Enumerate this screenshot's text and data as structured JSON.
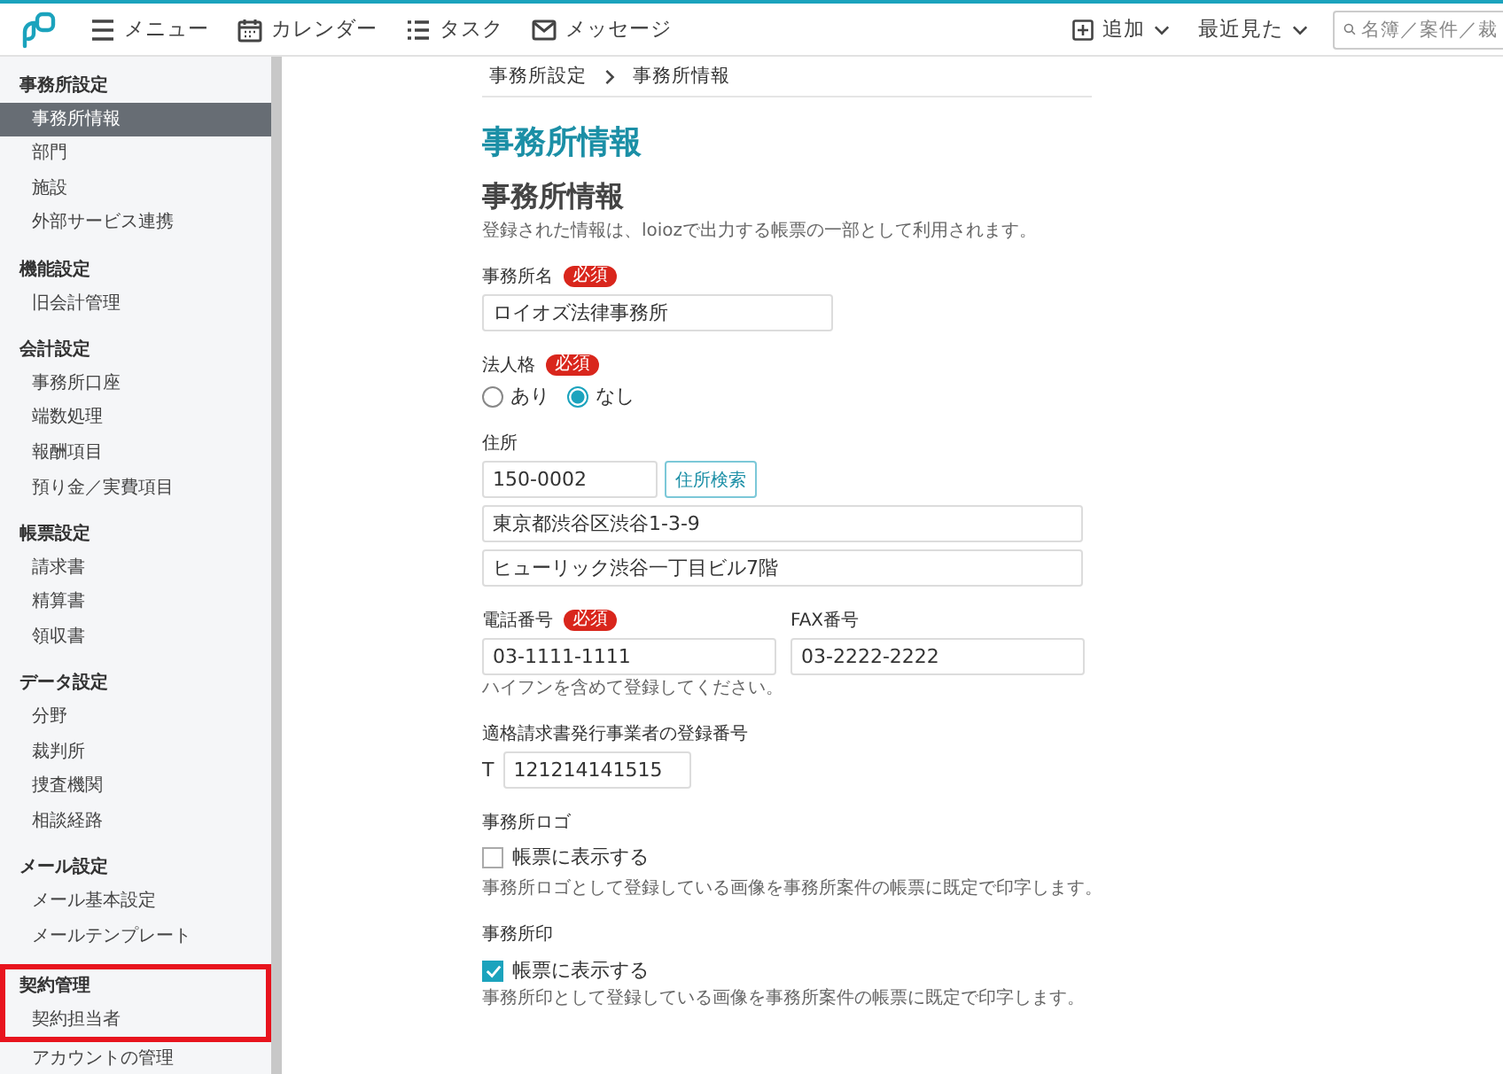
{
  "header": {
    "nav": [
      {
        "kind": "menu",
        "label": "メニュー"
      },
      {
        "kind": "calendar",
        "label": "カレンダー"
      },
      {
        "kind": "tasks",
        "label": "タスク"
      },
      {
        "kind": "message",
        "label": "メッセージ"
      }
    ],
    "add": "追加",
    "recent": "最近見た",
    "search": {
      "placeholder": "名簿／案件／裁"
    }
  },
  "sidebar": [
    {
      "kind": "header",
      "label": "事務所設定",
      "highlighted": false
    },
    {
      "kind": "item",
      "label": "事務所情報",
      "selected": true,
      "highlighted": false
    },
    {
      "kind": "item",
      "label": "部門",
      "selected": false,
      "highlighted": false
    },
    {
      "kind": "item",
      "label": "施設",
      "selected": false,
      "highlighted": false
    },
    {
      "kind": "item",
      "label": "外部サービス連携",
      "selected": false,
      "highlighted": false
    },
    {
      "kind": "header",
      "label": "機能設定",
      "highlighted": false
    },
    {
      "kind": "item",
      "label": "旧会計管理",
      "selected": false,
      "highlighted": false
    },
    {
      "kind": "header",
      "label": "会計設定",
      "highlighted": false
    },
    {
      "kind": "item",
      "label": "事務所口座",
      "selected": false,
      "highlighted": false
    },
    {
      "kind": "item",
      "label": "端数処理",
      "selected": false,
      "highlighted": false
    },
    {
      "kind": "item",
      "label": "報酬項目",
      "selected": false,
      "highlighted": false
    },
    {
      "kind": "item",
      "label": "預り金／実費項目",
      "selected": false,
      "highlighted": false
    },
    {
      "kind": "header",
      "label": "帳票設定",
      "highlighted": false
    },
    {
      "kind": "item",
      "label": "請求書",
      "selected": false,
      "highlighted": false
    },
    {
      "kind": "item",
      "label": "精算書",
      "selected": false,
      "highlighted": false
    },
    {
      "kind": "item",
      "label": "領収書",
      "selected": false,
      "highlighted": false
    },
    {
      "kind": "header",
      "label": "データ設定",
      "highlighted": false
    },
    {
      "kind": "item",
      "label": "分野",
      "selected": false,
      "highlighted": false
    },
    {
      "kind": "item",
      "label": "裁判所",
      "selected": false,
      "highlighted": false
    },
    {
      "kind": "item",
      "label": "捜査機関",
      "selected": false,
      "highlighted": false
    },
    {
      "kind": "item",
      "label": "相談経路",
      "selected": false,
      "highlighted": false
    },
    {
      "kind": "header",
      "label": "メール設定",
      "highlighted": false
    },
    {
      "kind": "item",
      "label": "メール基本設定",
      "selected": false,
      "highlighted": false
    },
    {
      "kind": "item",
      "label": "メールテンプレート",
      "selected": false,
      "highlighted": false
    },
    {
      "kind": "header",
      "label": "契約管理",
      "highlighted": true
    },
    {
      "kind": "item",
      "label": "契約担当者",
      "selected": false,
      "highlighted": true
    },
    {
      "kind": "item",
      "label": "アカウントの管理",
      "selected": false,
      "highlighted": false
    }
  ],
  "breadcrumb": [
    "事務所設定",
    "事務所情報"
  ],
  "page_title": "事務所情報",
  "form": {
    "title": "事務所情報",
    "description": "登録された情報は、loiozで出力する帳票の一部として利用されます。",
    "fields": [
      {
        "kind": "text",
        "label": "事務所名",
        "badge": "必須",
        "value": "ロイオズ法律事務所"
      },
      {
        "kind": "radio",
        "label": "法人格",
        "badge": "必須",
        "options": [
          {
            "label": "あり",
            "selected": false
          },
          {
            "label": "なし",
            "selected": true
          }
        ]
      },
      {
        "kind": "address",
        "label": "住所",
        "postal": "150-0002",
        "button": "住所検索",
        "lines": [
          "東京都渋谷区渋谷1-3-9",
          "ヒューリック渋谷一丁目ビル7階"
        ]
      },
      {
        "kind": "phone",
        "items": [
          {
            "label": "電話番号",
            "badge": "必須",
            "value": "03-1111-1111"
          },
          {
            "label": "FAX番号",
            "value": "03-2222-2222"
          }
        ],
        "hint": "ハイフンを含めて登録してください。"
      },
      {
        "kind": "registration",
        "label": "適格請求書発行事業者の登録番号",
        "prefix": "T",
        "value": "121214141515"
      },
      {
        "kind": "checkbox",
        "label": "事務所ロゴ",
        "option": "帳票に表示する",
        "checked": false,
        "hint": "事務所ロゴとして登録している画像を事務所案件の帳票に既定で印字します。"
      },
      {
        "kind": "checkbox",
        "label": "事務所印",
        "option": "帳票に表示する",
        "checked": true,
        "hint": "事務所印として登録している画像を事務所案件の帳票に既定で印字します。"
      }
    ]
  }
}
